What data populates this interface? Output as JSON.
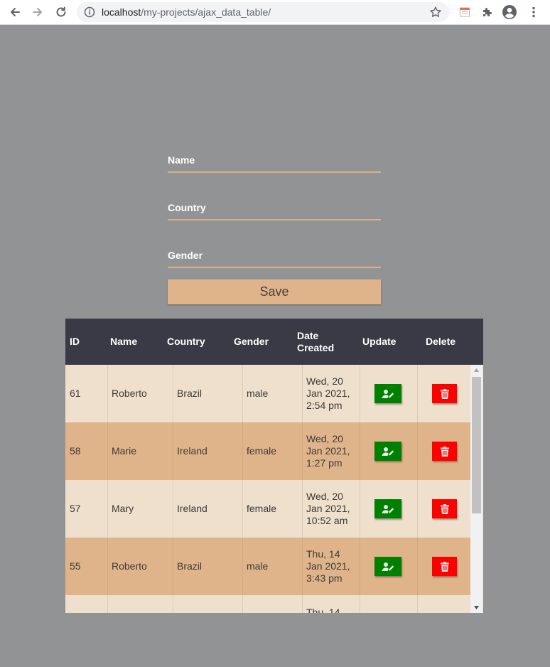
{
  "browser": {
    "url_host": "localhost",
    "url_path": "/my-projects/ajax_data_table/"
  },
  "form": {
    "name_label": "Name",
    "country_label": "Country",
    "gender_label": "Gender",
    "save_label": "Save"
  },
  "table": {
    "headers": {
      "id": "ID",
      "name": "Name",
      "country": "Country",
      "gender": "Gender",
      "date_line1": "Date",
      "date_line2": "Created",
      "update": "Update",
      "delete": "Delete"
    },
    "rows": [
      {
        "id": "61",
        "name": "Roberto",
        "country": "Brazil",
        "gender": "male",
        "date1": "Wed, 20",
        "date2": "Jan 2021,",
        "date3": "2:54 pm"
      },
      {
        "id": "58",
        "name": "Marie",
        "country": "Ireland",
        "gender": "female",
        "date1": "Wed, 20",
        "date2": "Jan 2021,",
        "date3": "1:27 pm"
      },
      {
        "id": "57",
        "name": "Mary",
        "country": "Ireland",
        "gender": "female",
        "date1": "Wed, 20",
        "date2": "Jan 2021,",
        "date3": "10:52 am"
      },
      {
        "id": "55",
        "name": "Roberto",
        "country": "Brazil",
        "gender": "male",
        "date1": "Thu, 14",
        "date2": "Jan 2021,",
        "date3": "3:43 pm"
      },
      {
        "id": "",
        "name": "",
        "country": "",
        "gender": "",
        "date1": "Thu, 14",
        "date2": "",
        "date3": ""
      }
    ]
  },
  "colors": {
    "page_bg": "#929395",
    "accent": "#e0b48a",
    "row_light": "#efe0cd",
    "header_bg": "#3a3a46",
    "update_btn": "#008000",
    "delete_btn": "#ff0000"
  },
  "icons": {
    "back": "arrow-left-icon",
    "forward": "arrow-right-icon",
    "reload": "reload-icon",
    "info": "info-icon",
    "star": "star-icon",
    "extension": "calendar-extension-icon",
    "puzzle": "puzzle-icon",
    "profile": "account-icon",
    "menu": "kebab-menu-icon",
    "update": "user-edit-icon",
    "delete": "trash-icon"
  }
}
